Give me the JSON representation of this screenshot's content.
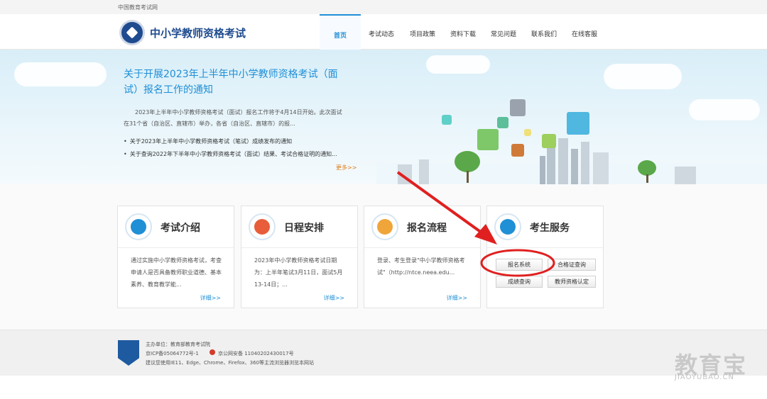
{
  "topbar": {
    "site_name": "中国教育考试网"
  },
  "header": {
    "logo_text": "中小学教师资格考试",
    "nav": [
      {
        "label": "首页",
        "active": true
      },
      {
        "label": "考试动态"
      },
      {
        "label": "项目政策"
      },
      {
        "label": "资料下载"
      },
      {
        "label": "常见问题"
      },
      {
        "label": "联系我们"
      },
      {
        "label": "在线客服"
      }
    ]
  },
  "banner": {
    "title": "关于开展2023年上半年中小学教师资格考试（面试）报名工作的通知",
    "description": "2023年上半年中小学教师资格考试（面试）报名工作将于4月14日开始。此次面试在31个省（自治区、直辖市）举办，各省（自治区、直辖市）的报...",
    "links": [
      "关于2023年上半年中小学教师资格考试（笔试）成绩发布的通知",
      "关于查询2022年下半年中小学教师资格考试（面试）结果、考试合格证明的通知..."
    ],
    "more": "更多>>"
  },
  "cards": [
    {
      "title": "考试介绍",
      "text": "通过实施中小学教师资格考试，考查申请人是否具备教师职业道德、基本素养、教育教学能...",
      "more": "详细>>"
    },
    {
      "title": "日程安排",
      "text": "2023年中小学教师资格考试日期为：上半年笔试3月11日，面试5月13-14日；...",
      "more": "详细>>"
    },
    {
      "title": "报名流程",
      "text": "登录、考生登录\"中小学教师资格考试\"（http://ntce.neea.edu...",
      "more": "详细>>"
    },
    {
      "title": "考生服务"
    }
  ],
  "services": {
    "registration": "报名系统",
    "certificate_query": "合格证查询",
    "score_query": "成绩查询",
    "qualification": "教师资格认定"
  },
  "footer": {
    "sponsor": "主办单位：教育部教育考试院",
    "icp": "京ICP备05064772号-1",
    "police": "京公网安备 11040202430017号",
    "browser_tip": "建议您使用IE11、Edge、Chrome、Firefox、360等主流浏览器浏览本网站"
  },
  "watermark": {
    "main": "教育宝",
    "sub": "JIAOYUBAO.CN"
  },
  "colors": {
    "accent": "#1f8fd6",
    "logo": "#1e4b8f",
    "annotation": "#e02020",
    "more": "#e07b16"
  },
  "icons": [
    "book-pen-icon",
    "checkmark-icon",
    "form-pen-icon",
    "clipboard-icon"
  ]
}
